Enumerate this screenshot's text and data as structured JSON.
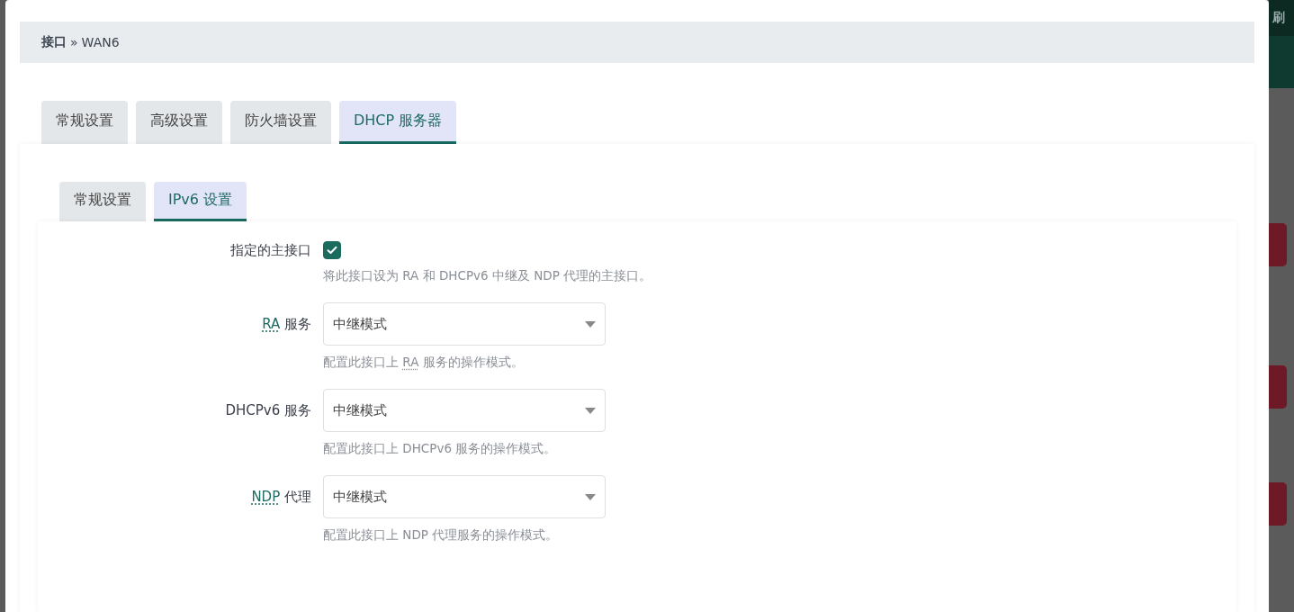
{
  "backdrop": {
    "header_text": "刷"
  },
  "breadcrumb": {
    "parent": "接口",
    "separator": "»",
    "current": "WAN6"
  },
  "tabs": [
    {
      "label": "常规设置",
      "selected": false
    },
    {
      "label": "高级设置",
      "selected": false
    },
    {
      "label": "防火墙设置",
      "selected": false
    },
    {
      "label": "DHCP 服务器",
      "selected": true
    }
  ],
  "subtabs": [
    {
      "label": "常规设置",
      "selected": false
    },
    {
      "label": "IPv6 设置",
      "selected": true
    }
  ],
  "fields": [
    {
      "kind": "checkbox",
      "label": [
        {
          "text": "指定的主接口"
        }
      ],
      "checked": true,
      "description": [
        {
          "text": "将此接口设为 RA 和 DHCPv6 中继及 NDP 代理的主接口。"
        }
      ]
    },
    {
      "kind": "select",
      "label": [
        {
          "text": "RA",
          "abbr": true
        },
        {
          "text": " 服务"
        }
      ],
      "value": "中继模式",
      "description": [
        {
          "text": "配置此接口上 "
        },
        {
          "text": "RA",
          "abbr": true
        },
        {
          "text": " 服务的操作模式。"
        }
      ]
    },
    {
      "kind": "select",
      "label": [
        {
          "text": "DHCPv6 服务"
        }
      ],
      "value": "中继模式",
      "description": [
        {
          "text": "配置此接口上 DHCPv6 服务的操作模式。"
        }
      ]
    },
    {
      "kind": "select",
      "label": [
        {
          "text": "NDP",
          "abbr": true
        },
        {
          "text": " 代理"
        }
      ],
      "value": "中继模式",
      "description": [
        {
          "text": "配置此接口上 NDP 代理服务的操作模式。"
        }
      ]
    }
  ]
}
